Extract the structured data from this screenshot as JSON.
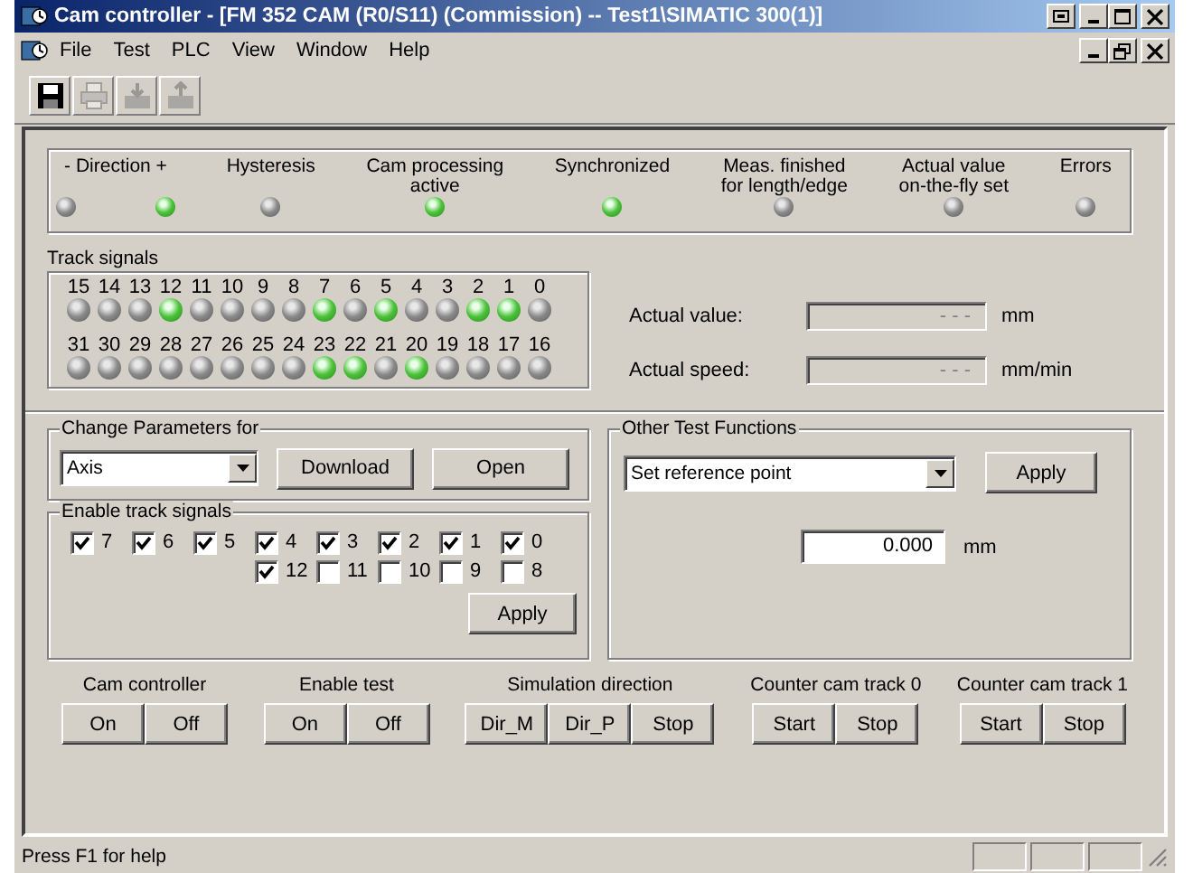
{
  "window": {
    "title": "Cam controller - [FM 352 CAM (R0/S11)  (Commission) -- Test1\\SIMATIC 300(1)]"
  },
  "menu": [
    "File",
    "Test",
    "PLC",
    "View",
    "Window",
    "Help"
  ],
  "toolbar": [
    {
      "kind": "save",
      "disabled": false
    },
    {
      "kind": "print",
      "disabled": true
    },
    {
      "kind": "download",
      "disabled": true
    },
    {
      "kind": "upload",
      "disabled": true
    }
  ],
  "status_indicators": [
    {
      "label": "- Direction +",
      "leds": [
        {
          "on": false
        },
        {
          "on": true
        }
      ]
    },
    {
      "label": "Hysteresis",
      "leds": [
        {
          "on": false
        }
      ]
    },
    {
      "label": "Cam processing\nactive",
      "leds": [
        {
          "on": true
        }
      ]
    },
    {
      "label": "Synchronized",
      "leds": [
        {
          "on": true
        }
      ]
    },
    {
      "label": "Meas. finished\nfor length/edge",
      "leds": [
        {
          "on": false
        }
      ]
    },
    {
      "label": "Actual value\non-the-fly set",
      "leds": [
        {
          "on": false
        }
      ]
    },
    {
      "label": "Errors",
      "leds": [
        {
          "on": false
        }
      ]
    }
  ],
  "track_signals": {
    "label": "Track signals",
    "rows": [
      [
        {
          "number": "15",
          "on": false
        },
        {
          "number": "14",
          "on": false
        },
        {
          "number": "13",
          "on": false
        },
        {
          "number": "12",
          "on": true
        },
        {
          "number": "11",
          "on": false
        },
        {
          "number": "10",
          "on": false
        },
        {
          "number": "9",
          "on": false
        },
        {
          "number": "8",
          "on": false
        },
        {
          "number": "7",
          "on": true
        },
        {
          "number": "6",
          "on": false
        },
        {
          "number": "5",
          "on": true
        },
        {
          "number": "4",
          "on": false
        },
        {
          "number": "3",
          "on": false
        },
        {
          "number": "2",
          "on": true
        },
        {
          "number": "1",
          "on": true
        },
        {
          "number": "0",
          "on": false
        }
      ],
      [
        {
          "number": "31",
          "on": false
        },
        {
          "number": "30",
          "on": false
        },
        {
          "number": "29",
          "on": false
        },
        {
          "number": "28",
          "on": false
        },
        {
          "number": "27",
          "on": false
        },
        {
          "number": "26",
          "on": false
        },
        {
          "number": "25",
          "on": false
        },
        {
          "number": "24",
          "on": false
        },
        {
          "number": "23",
          "on": true
        },
        {
          "number": "22",
          "on": true
        },
        {
          "number": "21",
          "on": false
        },
        {
          "number": "20",
          "on": true
        },
        {
          "number": "19",
          "on": false
        },
        {
          "number": "18",
          "on": false
        },
        {
          "number": "17",
          "on": false
        },
        {
          "number": "16",
          "on": false
        }
      ]
    ]
  },
  "readouts": [
    {
      "label": "Actual value:",
      "value": "- - -",
      "unit": "mm",
      "disabled": true
    },
    {
      "label": "Actual speed:",
      "value": "- - -",
      "unit": "mm/min",
      "disabled": true
    }
  ],
  "change_parameters": {
    "title": "Change Parameters for",
    "select": "Axis",
    "buttons": [
      "Download",
      "Open"
    ]
  },
  "enable_track_signals": {
    "title": "Enable track signals",
    "rows": [
      [
        {
          "label": "7",
          "checked": true
        },
        {
          "label": "6",
          "checked": true
        },
        {
          "label": "5",
          "checked": true
        },
        {
          "label": "4",
          "checked": true
        },
        {
          "label": "3",
          "checked": true
        },
        {
          "label": "2",
          "checked": true
        },
        {
          "label": "1",
          "checked": true
        },
        {
          "label": "0",
          "checked": true
        }
      ],
      [
        "",
        "",
        "",
        {
          "label": "12",
          "checked": true
        },
        {
          "label": "11",
          "checked": false
        },
        {
          "label": "10",
          "checked": false
        },
        {
          "label": "9",
          "checked": false
        },
        {
          "label": "8",
          "checked": false
        }
      ]
    ],
    "button": "Apply"
  },
  "other_test_functions": {
    "title": "Other Test Functions",
    "select": "Set reference point",
    "button": "Apply",
    "value": "0.000",
    "unit": "mm"
  },
  "button_groups": [
    {
      "label": "Cam controller",
      "buttons": [
        "On",
        "Off"
      ]
    },
    {
      "label": "Enable test",
      "buttons": [
        "On",
        "Off"
      ]
    },
    {
      "label": "Simulation direction",
      "buttons": [
        "Dir_M",
        "Dir_P",
        "Stop"
      ]
    },
    {
      "label": "Counter cam track 0",
      "buttons": [
        "Start",
        "Stop"
      ]
    },
    {
      "label": "Counter cam track 1",
      "buttons": [
        "Start",
        "Stop"
      ]
    }
  ],
  "status_bar": {
    "text": "Press F1 for help"
  }
}
